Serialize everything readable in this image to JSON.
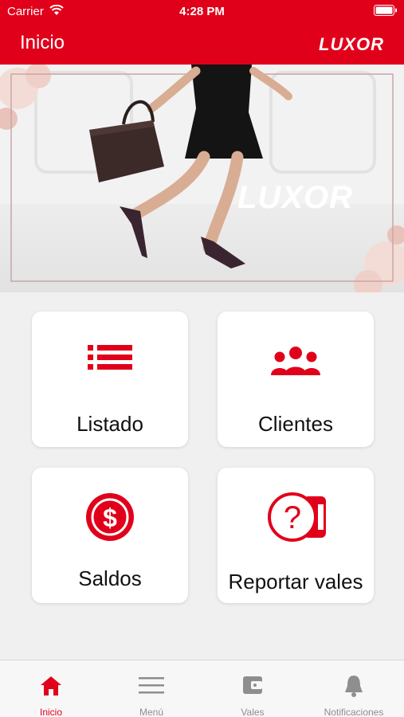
{
  "status_bar": {
    "carrier": "Carrier",
    "time": "4:28 PM"
  },
  "nav": {
    "title": "Inicio",
    "logo": "LUXOR"
  },
  "banner": {
    "logo": "LUXOR"
  },
  "tiles": [
    {
      "label": "Listado",
      "icon": "list-icon"
    },
    {
      "label": "Clientes",
      "icon": "group-icon"
    },
    {
      "label": "Saldos",
      "icon": "dollar-coin-icon"
    },
    {
      "label": "Reportar vales",
      "icon": "question-ticket-icon"
    }
  ],
  "tabs": [
    {
      "label": "Inicio",
      "icon": "home-icon",
      "active": true
    },
    {
      "label": "Menú",
      "icon": "hamburger-icon",
      "active": false
    },
    {
      "label": "Vales",
      "icon": "wallet-icon",
      "active": false
    },
    {
      "label": "Notificaciones",
      "icon": "bell-icon",
      "active": false
    }
  ],
  "colors": {
    "brand_red": "#e1001a",
    "inactive_gray": "#8e8e8e",
    "background": "#f0f0f0"
  }
}
